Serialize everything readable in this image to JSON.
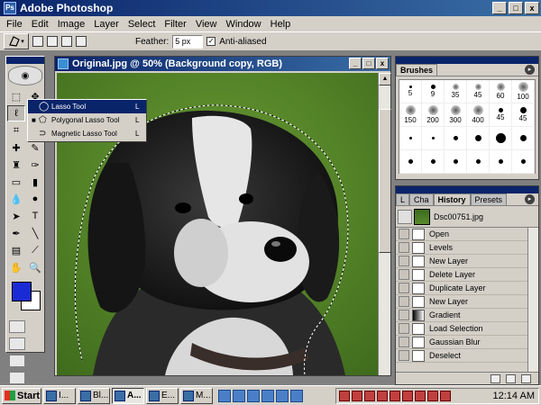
{
  "app": {
    "title": "Adobe Photoshop",
    "window_buttons": [
      "_",
      "□",
      "x"
    ]
  },
  "menu": [
    "File",
    "Edit",
    "Image",
    "Layer",
    "Select",
    "Filter",
    "View",
    "Window",
    "Help"
  ],
  "options": {
    "feather_label": "Feather:",
    "feather_value": "5 px",
    "antialias_label": "Anti-aliased",
    "antialias_checked": "✓"
  },
  "tool_flyout": {
    "items": [
      {
        "label": "Lasso Tool",
        "key": "L",
        "bullet": ""
      },
      {
        "label": "Polygonal Lasso Tool",
        "key": "L",
        "bullet": "■"
      },
      {
        "label": "Magnetic Lasso Tool",
        "key": "L",
        "bullet": ""
      }
    ]
  },
  "document": {
    "title": "Original.jpg @ 50% (Background copy, RGB)",
    "colors": {
      "foreground": "#1a2bd6",
      "background": "#ffffff"
    }
  },
  "brushes": {
    "tab": "Brushes",
    "cells": [
      {
        "size": "5",
        "r": 1
      },
      {
        "size": "9",
        "r": 2
      },
      {
        "size": "35",
        "r": 3,
        "soft": true
      },
      {
        "size": "45",
        "r": 3,
        "soft": true
      },
      {
        "size": "60",
        "r": 4,
        "soft": true
      },
      {
        "size": "100",
        "r": 5,
        "soft": true
      },
      {
        "size": "150",
        "r": 5,
        "soft": true
      },
      {
        "size": "200",
        "r": 5,
        "soft": true
      },
      {
        "size": "300",
        "r": 5,
        "soft": true
      },
      {
        "size": "400",
        "r": 5,
        "soft": true
      },
      {
        "size": "45",
        "r": 2
      },
      {
        "size": "45",
        "r": 3
      },
      {
        "size": "",
        "r": 1
      },
      {
        "size": "",
        "r": 1
      },
      {
        "size": "",
        "r": 2
      },
      {
        "size": "",
        "r": 3
      },
      {
        "size": "",
        "r": 5
      },
      {
        "size": "",
        "r": 3
      },
      {
        "size": "",
        "r": 2
      },
      {
        "size": "",
        "r": 2
      },
      {
        "size": "",
        "r": 2
      },
      {
        "size": "",
        "r": 2
      },
      {
        "size": "",
        "r": 2
      },
      {
        "size": "",
        "r": 2
      }
    ]
  },
  "history": {
    "tabs": [
      "L",
      "Cha",
      "History",
      "Presets"
    ],
    "snapshot_label": "Dsc00751.jpg",
    "items": [
      {
        "label": "Open",
        "icon": "doc"
      },
      {
        "label": "Levels",
        "icon": "doc"
      },
      {
        "label": "New Layer",
        "icon": "doc"
      },
      {
        "label": "Delete Layer",
        "icon": "doc"
      },
      {
        "label": "Duplicate Layer",
        "icon": "doc"
      },
      {
        "label": "New Layer",
        "icon": "doc"
      },
      {
        "label": "Gradient",
        "icon": "grad"
      },
      {
        "label": "Load Selection",
        "icon": "doc"
      },
      {
        "label": "Gaussian Blur",
        "icon": "doc"
      },
      {
        "label": "Deselect",
        "icon": "doc"
      }
    ]
  },
  "taskbar": {
    "start_label": "Start",
    "tasks": [
      {
        "label": "I...",
        "active": false
      },
      {
        "label": "Bl...",
        "active": false
      },
      {
        "label": "A...",
        "active": true
      },
      {
        "label": "E...",
        "active": false
      },
      {
        "label": "M...",
        "active": false
      }
    ],
    "clock": "12:14 AM"
  }
}
